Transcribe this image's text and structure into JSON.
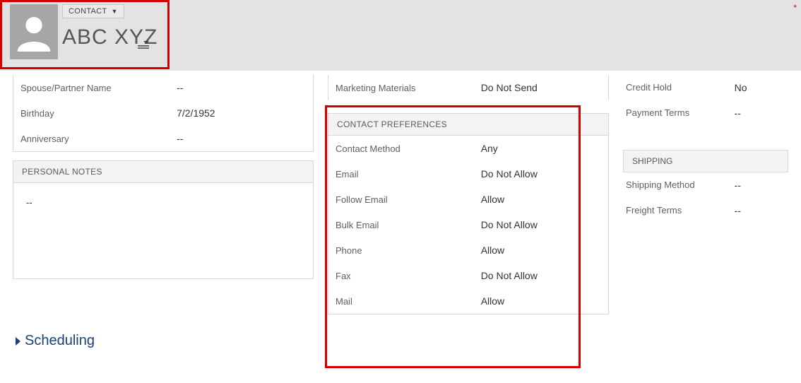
{
  "header": {
    "entity_type": "CONTACT",
    "contact_name": "ABC XYZ"
  },
  "asterisk": "*",
  "personal": {
    "fields": {
      "spouse_label": "Spouse/Partner Name",
      "spouse_value": "--",
      "birthday_label": "Birthday",
      "birthday_value": "7/2/1952",
      "anniversary_label": "Anniversary",
      "anniversary_value": "--"
    },
    "notes_heading": "PERSONAL NOTES",
    "notes_value": "--"
  },
  "marketing": {
    "materials_label": "Marketing Materials",
    "materials_value": "Do Not Send"
  },
  "preferences": {
    "heading": "CONTACT PREFERENCES",
    "rows": {
      "contact_method_label": "Contact Method",
      "contact_method_value": "Any",
      "email_label": "Email",
      "email_value": "Do Not Allow",
      "follow_email_label": "Follow Email",
      "follow_email_value": "Allow",
      "bulk_email_label": "Bulk Email",
      "bulk_email_value": "Do Not Allow",
      "phone_label": "Phone",
      "phone_value": "Allow",
      "fax_label": "Fax",
      "fax_value": "Do Not Allow",
      "mail_label": "Mail",
      "mail_value": "Allow"
    }
  },
  "billing": {
    "credit_hold_label": "Credit Hold",
    "credit_hold_value": "No",
    "payment_terms_label": "Payment Terms",
    "payment_terms_value": "--"
  },
  "shipping": {
    "heading": "SHIPPING",
    "shipping_method_label": "Shipping Method",
    "shipping_method_value": "--",
    "freight_terms_label": "Freight Terms",
    "freight_terms_value": "--"
  },
  "scheduling": {
    "label": "Scheduling"
  }
}
